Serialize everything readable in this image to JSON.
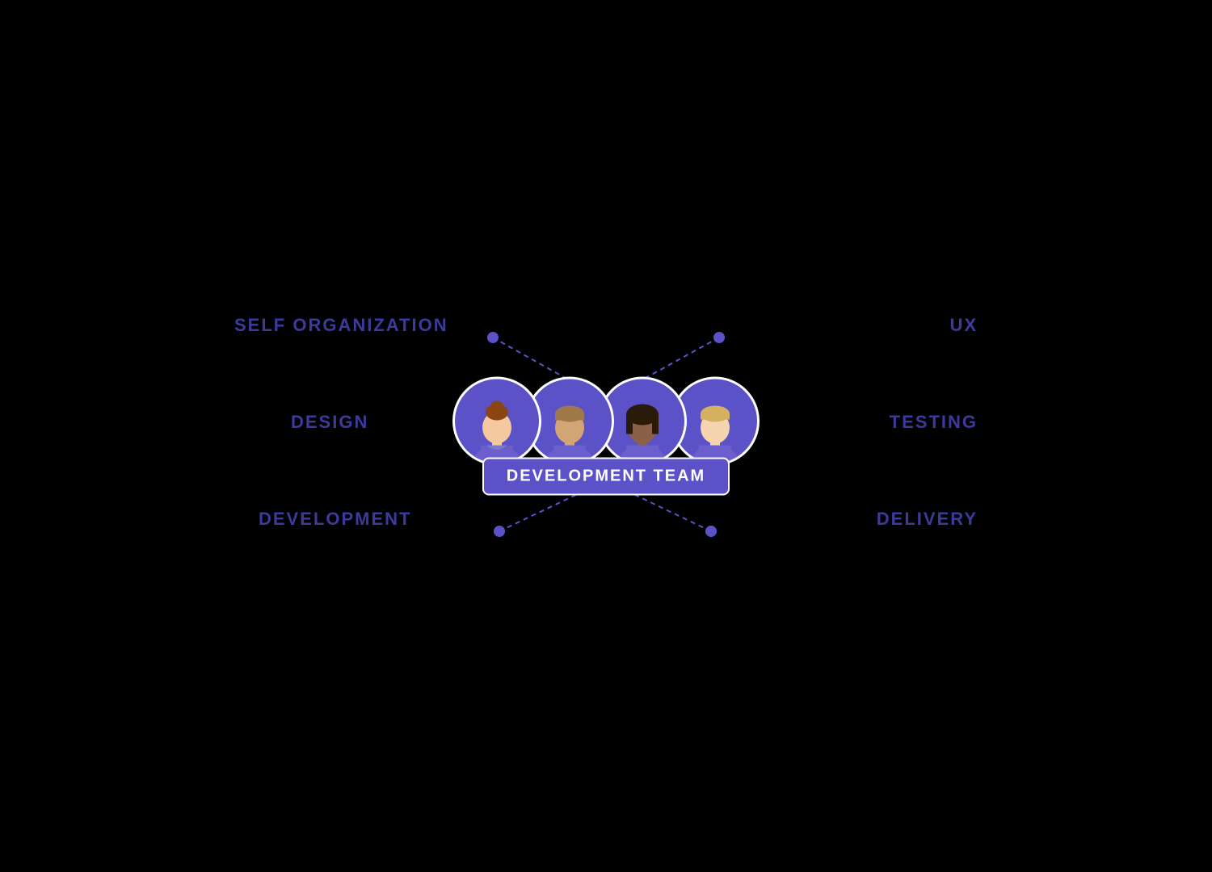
{
  "diagram": {
    "title": "DEVELOPMENT TEAM",
    "left_labels": [
      {
        "id": "self-organization",
        "text": "SELF ORGANIZATION"
      },
      {
        "id": "design",
        "text": "DESIGN"
      },
      {
        "id": "development",
        "text": "DEVELOPMENT"
      }
    ],
    "right_labels": [
      {
        "id": "ux",
        "text": "UX"
      },
      {
        "id": "testing",
        "text": "TESTING"
      },
      {
        "id": "delivery",
        "text": "DELIVERY"
      }
    ],
    "colors": {
      "purple": "#5b52c8",
      "label": "#3d3a9e",
      "dot": "#5b52c8",
      "background": "#000000"
    }
  }
}
